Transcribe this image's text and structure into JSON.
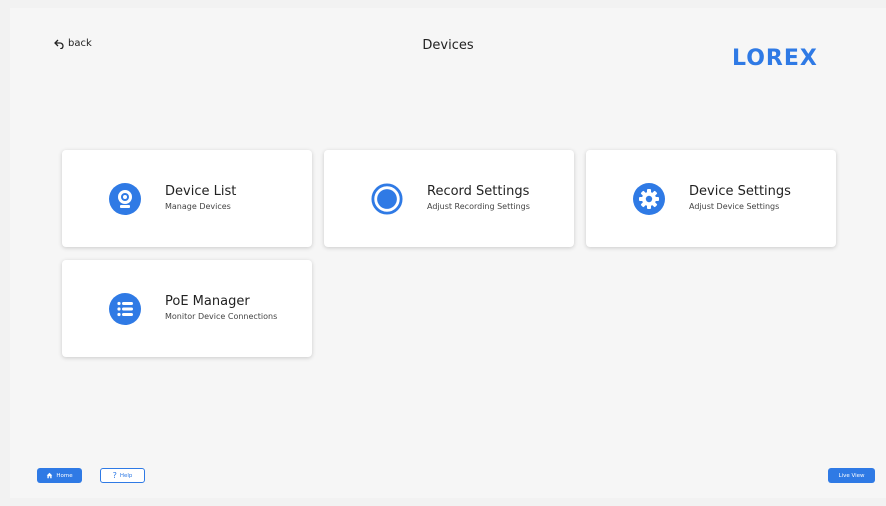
{
  "header": {
    "back_label": "back",
    "title": "Devices",
    "logo_text": "LOREX"
  },
  "cards": [
    {
      "label": "Device List",
      "sub": "Manage Devices",
      "icon": "camera-icon"
    },
    {
      "label": "Record Settings",
      "sub": "Adjust Recording Settings",
      "icon": "record-icon"
    },
    {
      "label": "Device Settings",
      "sub": "Adjust Device Settings",
      "icon": "gear-icon"
    },
    {
      "label": "PoE Manager",
      "sub": "Monitor Device Connections",
      "icon": "list-icon"
    }
  ],
  "footer": {
    "home_label": "Home",
    "help_label": "Help",
    "live_view_label": "Live View"
  },
  "colors": {
    "accent": "#2f7ae5",
    "background": "#f6f6f6",
    "card": "#ffffff"
  }
}
